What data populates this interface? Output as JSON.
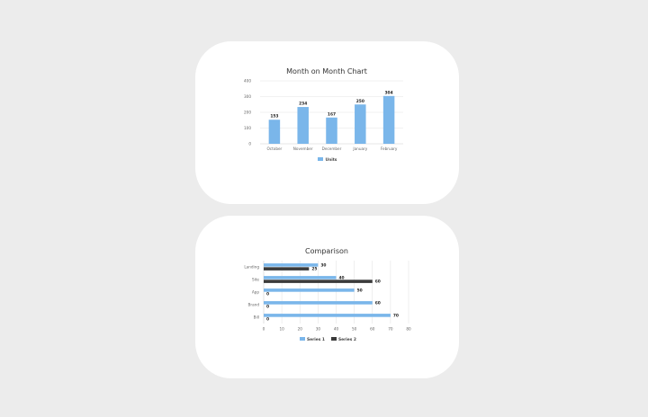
{
  "colors": {
    "series1": "#7ab6ea",
    "series2": "#3b3b3b",
    "grid": "#e4e4e4",
    "axis": "#cfcfcf"
  },
  "chart_data": [
    {
      "type": "bar",
      "title": "Month on Month Chart",
      "categories": [
        "October",
        "November",
        "December",
        "January",
        "February"
      ],
      "series": [
        {
          "name": "Units",
          "values": [
            153,
            234,
            167,
            250,
            304
          ]
        }
      ],
      "ylim": [
        0,
        400
      ],
      "yticks": [
        0,
        100,
        200,
        300,
        400
      ],
      "grid": true,
      "legend": "bottom"
    },
    {
      "type": "bar",
      "orientation": "horizontal",
      "title": "Comparison",
      "categories": [
        "Landing",
        "Site",
        "App",
        "Brand",
        "Bill"
      ],
      "series": [
        {
          "name": "Series 1",
          "values": [
            30,
            40,
            50,
            60,
            70
          ]
        },
        {
          "name": "Series 2",
          "values": [
            25,
            60,
            0,
            0,
            0
          ]
        }
      ],
      "xlim": [
        0,
        80
      ],
      "xticks": [
        0,
        10,
        20,
        30,
        40,
        50,
        60,
        70,
        80
      ],
      "grid": true,
      "legend": "bottom"
    }
  ]
}
